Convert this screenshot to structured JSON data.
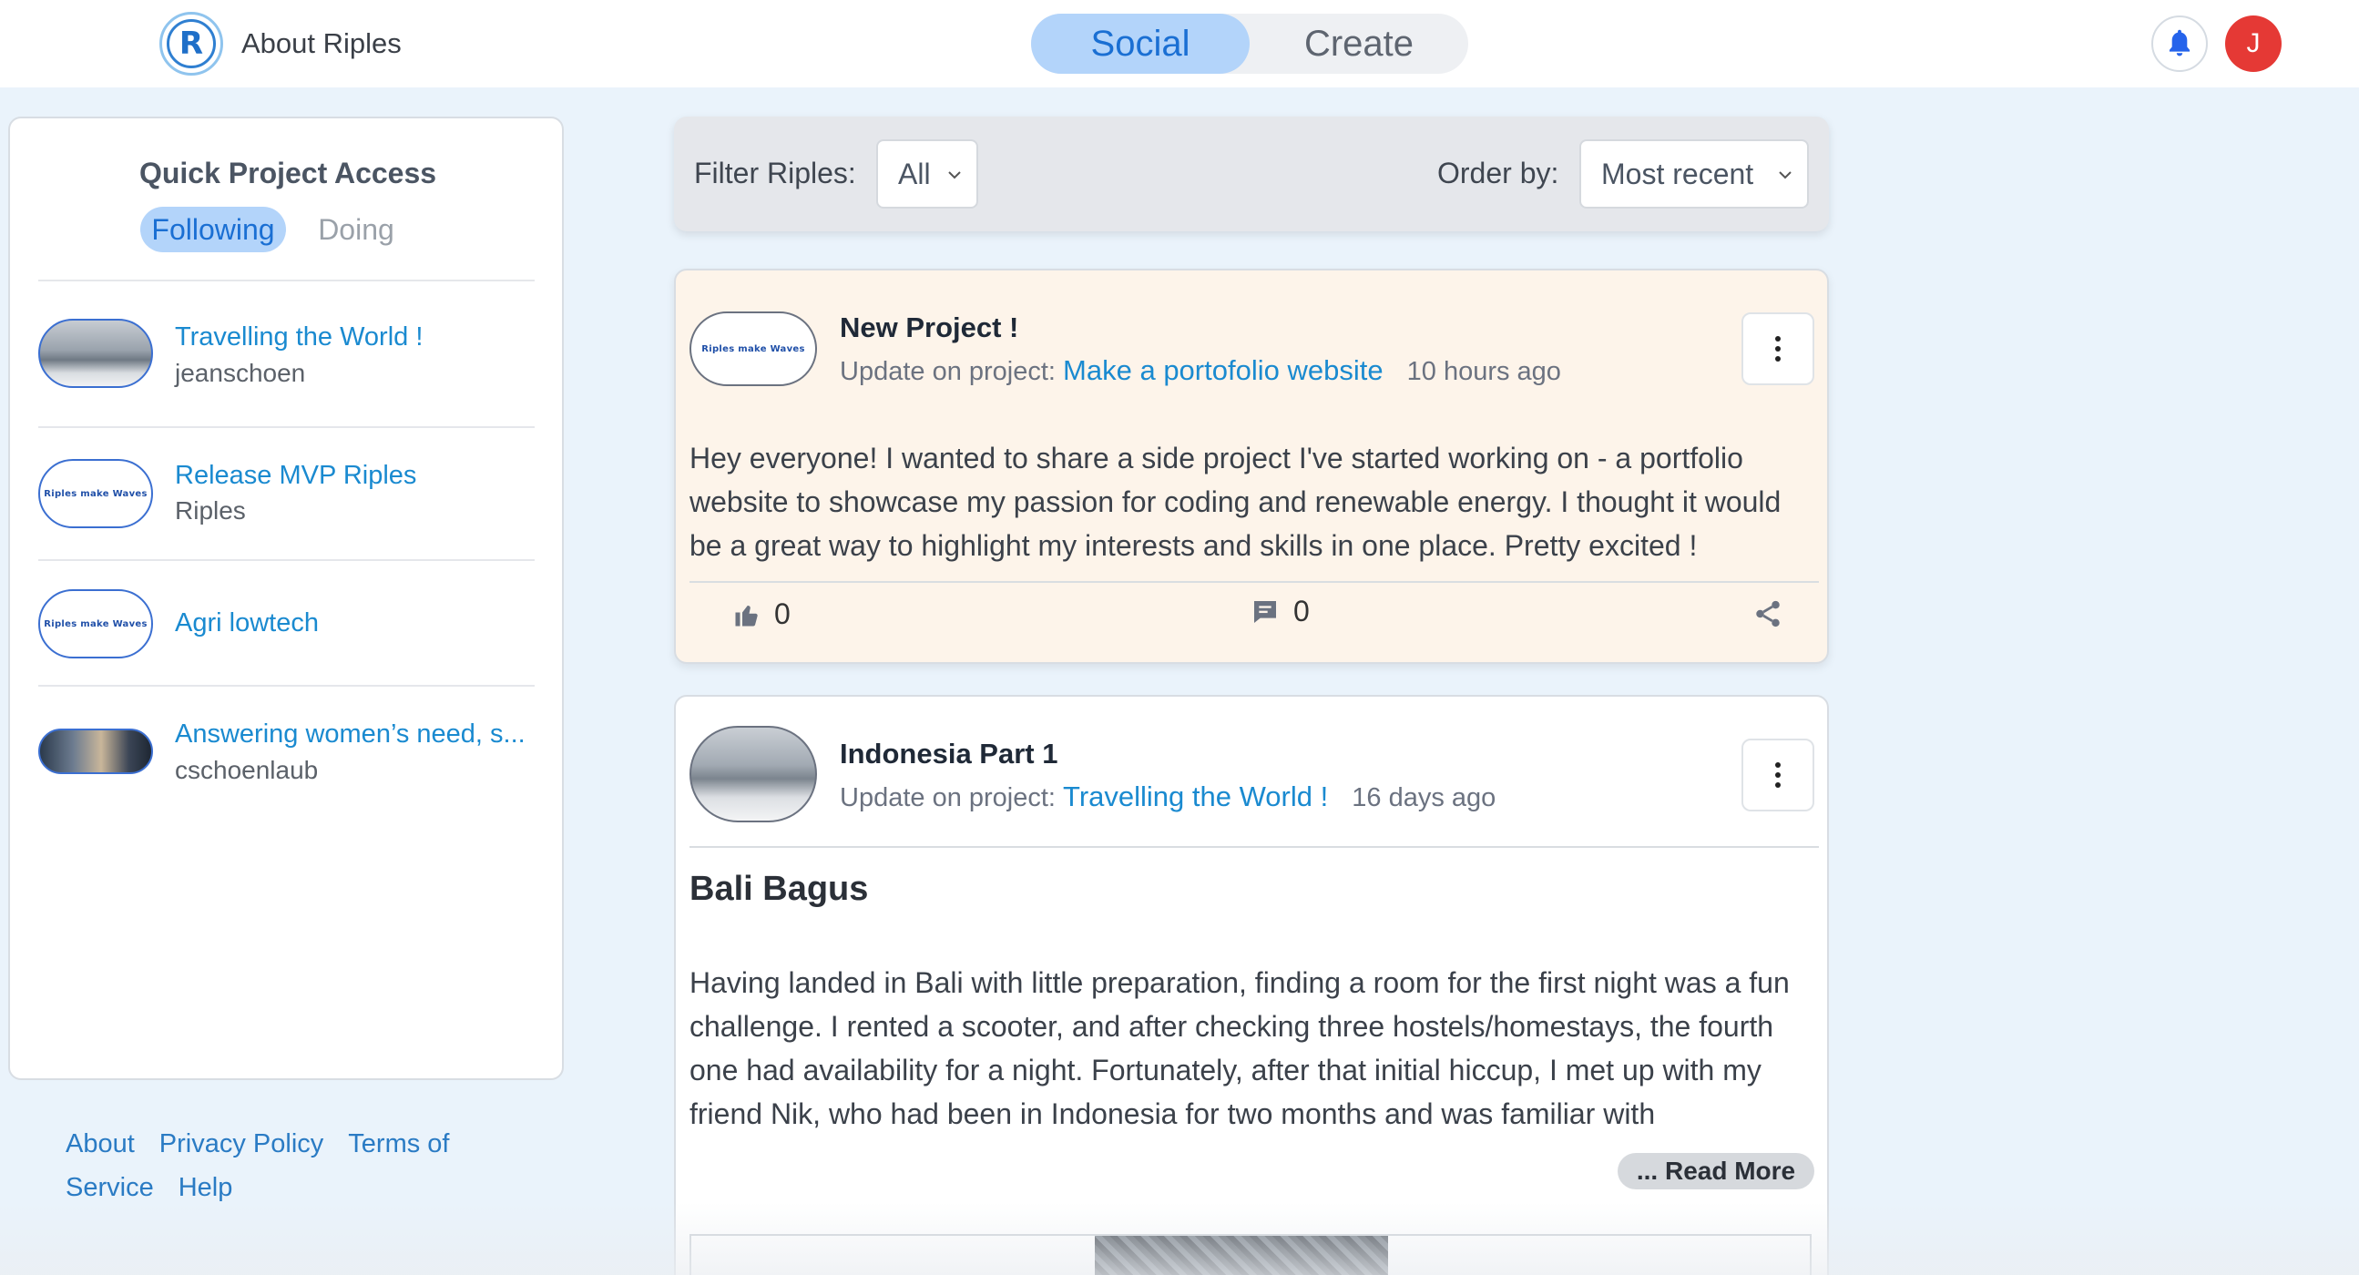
{
  "header": {
    "brand": "About Riples",
    "logo_letter": "R",
    "tabs": [
      "Social",
      "Create"
    ],
    "active_tab": "Social",
    "avatar_letter": "J",
    "colors": {
      "accent": "#1a6fd3",
      "active_tab_bg": "#b3d4fa",
      "avatar_bg": "#e53935",
      "link": "#1a8ad0"
    }
  },
  "quick_access": {
    "title": "Quick Project Access",
    "tabs": [
      "Following",
      "Doing"
    ],
    "active_tab": "Following",
    "items": [
      {
        "name": "Travelling the World !",
        "owner": "jeanschoen",
        "thumb": "photo"
      },
      {
        "name": "Release MVP Riples",
        "owner": "Riples",
        "thumb": "logo"
      },
      {
        "name": "Agri lowtech",
        "owner": "",
        "thumb": "logo"
      },
      {
        "name": "Answering women’s need, s...",
        "owner": "cschoenlaub",
        "thumb": "photo"
      }
    ],
    "logo_text": "Riples make Waves"
  },
  "footer": {
    "links": [
      "About",
      "Privacy Policy",
      "Terms of Service",
      "Help"
    ]
  },
  "filters": {
    "filter_label": "Filter Riples:",
    "filter_value": "All",
    "order_label": "Order by:",
    "order_value": "Most recent"
  },
  "posts": [
    {
      "title": "New Project !",
      "update_prefix": "Update on project:",
      "project": "Make a portofolio website",
      "time": "10 hours ago",
      "avatar": "logo",
      "avatar_text": "Riples make Waves",
      "body": "Hey everyone! I wanted to share a side project I've started working on - a portfolio website to showcase my passion for coding and renewable energy. I thought it would be a great way to highlight my interests and skills in one place. Pretty excited !",
      "likes": "0",
      "comments": "0"
    },
    {
      "title": "Indonesia Part 1",
      "update_prefix": "Update on project:",
      "project": "Travelling the World !",
      "time": "16 days ago",
      "avatar": "photo",
      "heading": "Bali Bagus",
      "body": "Having landed in Bali with little preparation, finding a room for the first night was a fun challenge. I rented a scooter, and after checking three hostels/homestays, the fourth one had availability for a night. Fortunately, after that initial hiccup, I met up with my friend Nik, who had been in Indonesia for two months and was familiar with",
      "read_more": "... Read More"
    }
  ]
}
